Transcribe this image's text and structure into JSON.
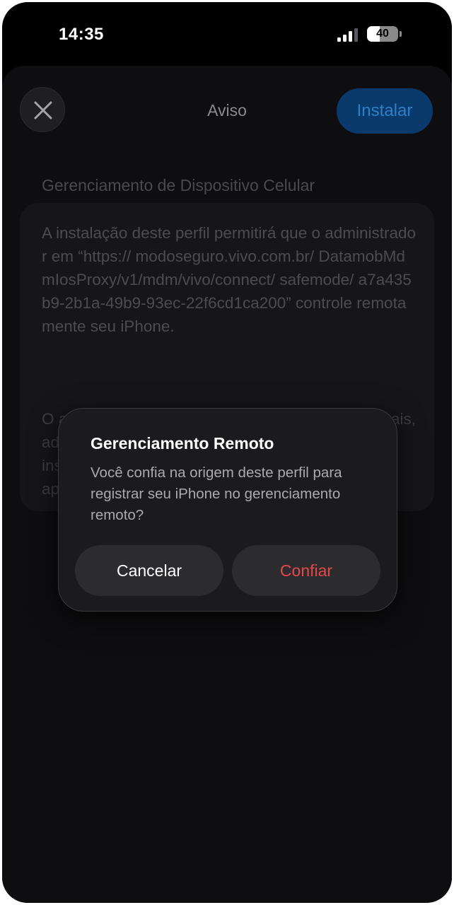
{
  "status_bar": {
    "time": "14:35",
    "battery_level": "40",
    "battery_fraction": 0.4,
    "signal_bars_active": 3,
    "signal_bars_total": 4
  },
  "header": {
    "title": "Aviso",
    "install_label": "Instalar",
    "close_icon": "close-icon"
  },
  "profile": {
    "section_header": "Gerenciamento de Dispositivo Celular",
    "description": "A instalação deste perfil permitirá que o administrador em “https:// modoseguro.vivo.com.br/ DatamobMdmIosProxy/v1/mdm/vivo/connect/ safemode/ a7a435b9-2b1a-49b9-93ec-22f6cd1ca200” controle remotamente seu iPhone.",
    "obscured_fragments": [
      "O a",
      "ais,",
      "ad",
      "ins",
      "ap"
    ]
  },
  "alert": {
    "title": "Gerenciamento Remoto",
    "message": "Você confia na origem deste perfil para registrar seu iPhone no gerenciamento remoto?",
    "cancel_label": "Cancelar",
    "confirm_label": "Confiar"
  },
  "colors": {
    "accent_blue": "#0a3a6b",
    "destructive_red": "#e5484a",
    "background": "#000000"
  }
}
